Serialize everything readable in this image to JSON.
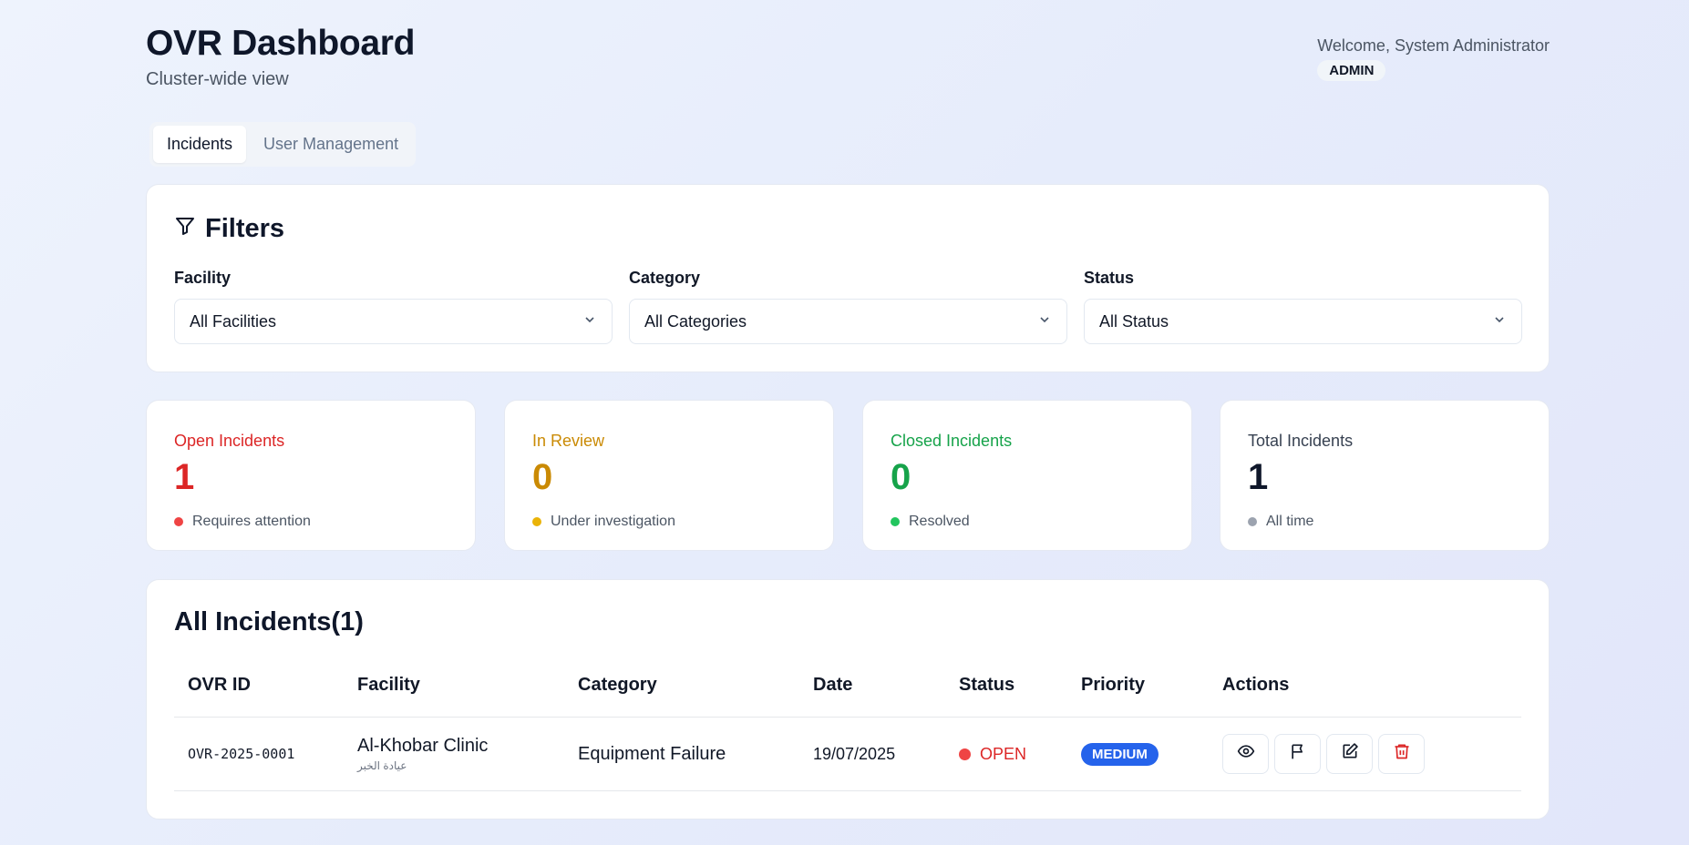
{
  "header": {
    "title": "OVR Dashboard",
    "subtitle": "Cluster-wide view",
    "welcome": "Welcome, System Administrator",
    "role": "ADMIN"
  },
  "tabs": [
    {
      "label": "Incidents",
      "active": true
    },
    {
      "label": "User Management",
      "active": false
    }
  ],
  "filters": {
    "title": "Filters",
    "facility": {
      "label": "Facility",
      "value": "All Facilities"
    },
    "category": {
      "label": "Category",
      "value": "All Categories"
    },
    "status": {
      "label": "Status",
      "value": "All Status"
    }
  },
  "stats": [
    {
      "label": "Open Incidents",
      "value": "1",
      "note": "Requires attention",
      "color": "#dc2626",
      "dot": "#ef4444"
    },
    {
      "label": "In Review",
      "value": "0",
      "note": "Under investigation",
      "color": "#ca8a04",
      "dot": "#eab308"
    },
    {
      "label": "Closed Incidents",
      "value": "0",
      "note": "Resolved",
      "color": "#16a34a",
      "dot": "#22c55e"
    },
    {
      "label": "Total Incidents",
      "value": "1",
      "note": "All time",
      "color": "#0f172a",
      "dot": "#9ca3af"
    }
  ],
  "incidents": {
    "title": "All Incidents(1)",
    "columns": [
      "OVR ID",
      "Facility",
      "Category",
      "Date",
      "Status",
      "Priority",
      "Actions"
    ],
    "rows": [
      {
        "id": "OVR-2025-0001",
        "facility": "Al-Khobar Clinic",
        "facility_ar": "عيادة الخبر",
        "category": "Equipment Failure",
        "date": "19/07/2025",
        "status": "OPEN",
        "priority": "MEDIUM"
      }
    ],
    "actions": [
      "eye-icon",
      "flag-icon",
      "edit-icon",
      "trash-icon"
    ]
  }
}
